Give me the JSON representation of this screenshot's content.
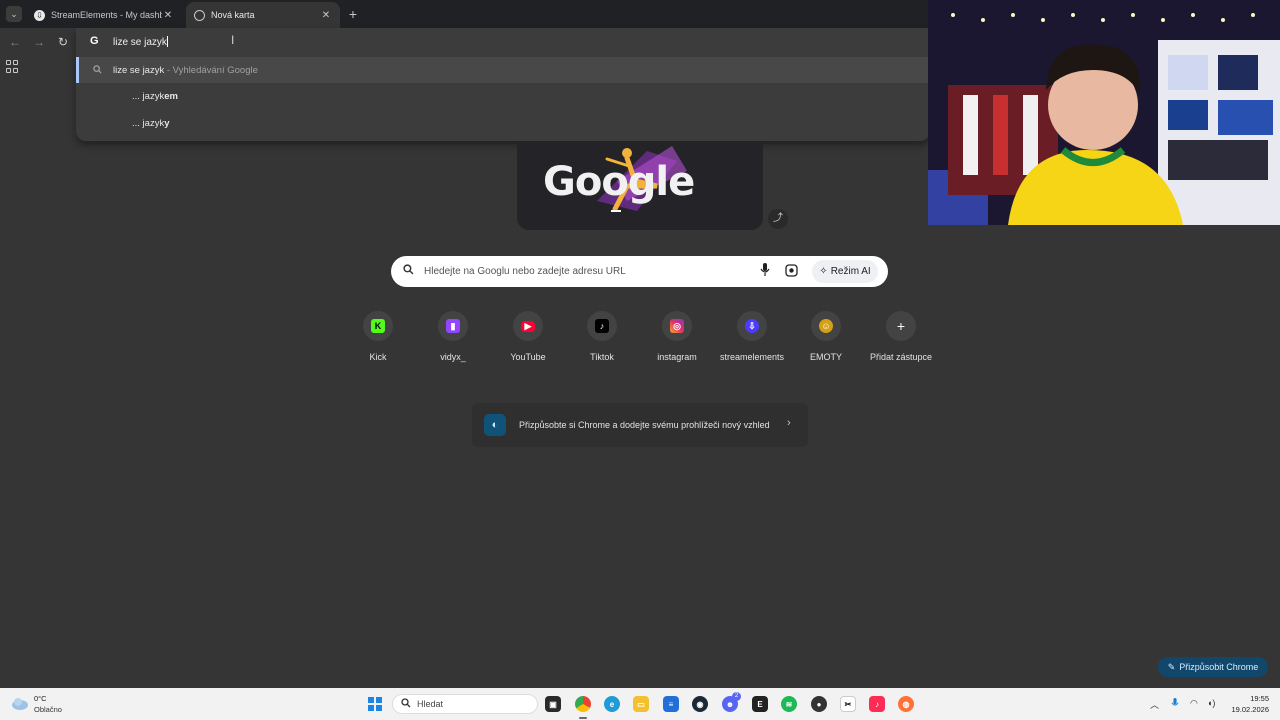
{
  "browser": {
    "tabs": [
      {
        "label": "StreamElements - My dashboar",
        "active": false
      },
      {
        "label": "Nová karta",
        "active": true
      }
    ]
  },
  "omnibox": {
    "typed_text": "lize se jazyk",
    "suggestions": [
      {
        "text": "lize se jazyk",
        "suffix": " - Vyhledávání Google"
      },
      {
        "prefix": "... jazyk",
        "bold": "em"
      },
      {
        "prefix": "... jazyk",
        "bold": "y"
      }
    ]
  },
  "doodle": {
    "text": "Google"
  },
  "search": {
    "placeholder": "Hledejte na Googlu nebo zadejte adresu URL",
    "ai_mode_label": "Režim AI"
  },
  "shortcuts": [
    {
      "label": "Kick",
      "icon": "kick-icon",
      "color": "#53fc18"
    },
    {
      "label": "vidyx_",
      "icon": "twitch-icon",
      "color": "#9146ff"
    },
    {
      "label": "YouTube",
      "icon": "youtube-icon",
      "color": "#ff0033"
    },
    {
      "label": "Tiktok",
      "icon": "tiktok-icon",
      "color": "#000000"
    },
    {
      "label": "instagram",
      "icon": "instagram-icon",
      "color": "#e1306c"
    },
    {
      "label": "streamelements",
      "icon": "streamelements-icon",
      "color": "#4b3bff"
    },
    {
      "label": "EMOTY",
      "icon": "emote-icon",
      "color": "#d4a017"
    },
    {
      "label": "Přidat zástupce",
      "icon": "plus-icon",
      "color": "#e3e3e3"
    }
  ],
  "customize_card": {
    "text": "Přizpůsobte si Chrome a dodejte svému prohlížeči nový vzhled"
  },
  "customize_chrome_button": {
    "label": "Přizpůsobit Chrome"
  },
  "taskbar": {
    "weather": {
      "temp": "0°C",
      "condition": "Oblačno"
    },
    "search_label": "Hledat",
    "discord_badge": "2",
    "clock": {
      "time": "19:55",
      "date": "19.02.2026"
    }
  }
}
